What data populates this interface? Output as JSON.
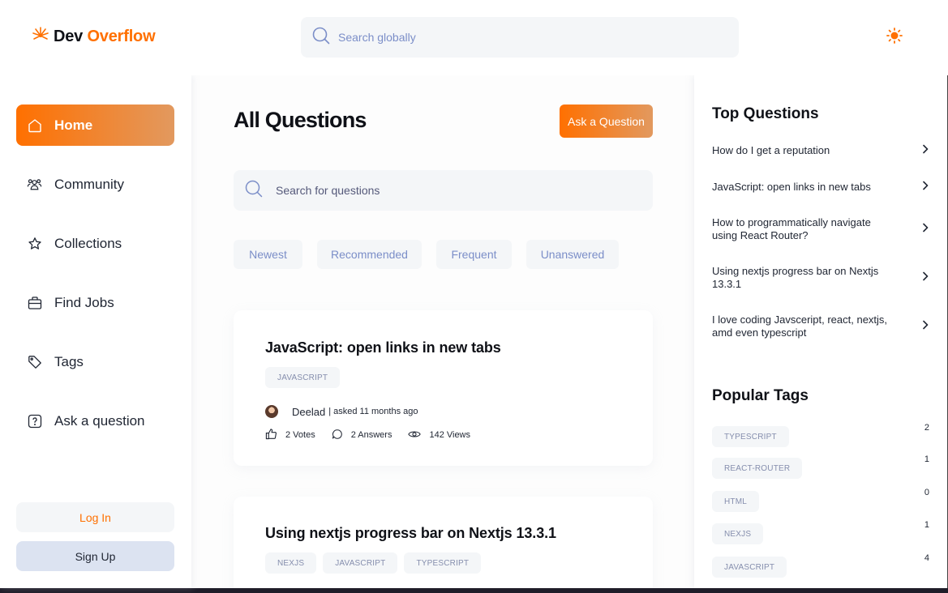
{
  "brand": {
    "name_part1": "Dev",
    "name_part2": "Overflow",
    "accent": "#ff7000"
  },
  "header": {
    "search_placeholder": "Search globally",
    "theme_icon": "sun-icon"
  },
  "sidebar": {
    "items": [
      {
        "label": "Home",
        "icon": "home-icon",
        "active": true
      },
      {
        "label": "Community",
        "icon": "users-icon",
        "active": false
      },
      {
        "label": "Collections",
        "icon": "star-icon",
        "active": false
      },
      {
        "label": "Find Jobs",
        "icon": "briefcase-icon",
        "active": false
      },
      {
        "label": "Tags",
        "icon": "tag-icon",
        "active": false
      },
      {
        "label": "Ask a question",
        "icon": "question-icon",
        "active": false
      }
    ],
    "login_label": "Log In",
    "signup_label": "Sign Up"
  },
  "main": {
    "title": "All Questions",
    "ask_button": "Ask a Question",
    "search_placeholder": "Search for questions",
    "filters": [
      "Newest",
      "Recommended",
      "Frequent",
      "Unanswered"
    ],
    "questions": [
      {
        "title": "JavaScript: open links in new tabs",
        "tags": [
          "JAVASCRIPT"
        ],
        "author": "Deelad",
        "asked": "| asked 11 months ago",
        "votes": "2 Votes",
        "answers": "2 Answers",
        "views": "142 Views"
      },
      {
        "title": "Using nextjs progress bar on Nextjs 13.3.1",
        "tags": [
          "NEXJS",
          "JAVASCRIPT",
          "TYPESCRIPT"
        ]
      }
    ]
  },
  "right": {
    "top_questions_title": "Top Questions",
    "top_questions": [
      "How do I get a reputation",
      "JavaScript: open links in new tabs",
      "How to programmatically navigate using React Router?",
      "Using nextjs progress bar on Nextjs 13.3.1",
      "I love coding Javsceript, react, nextjs, amd even typescript"
    ],
    "popular_tags_title": "Popular Tags",
    "popular_tags": [
      {
        "name": "TYPESCRIPT",
        "count": "2"
      },
      {
        "name": "REACT-ROUTER",
        "count": "1"
      },
      {
        "name": "HTML",
        "count": "0"
      },
      {
        "name": "NEXJS",
        "count": "1"
      },
      {
        "name": "JAVASCRIPT",
        "count": "4"
      }
    ]
  }
}
